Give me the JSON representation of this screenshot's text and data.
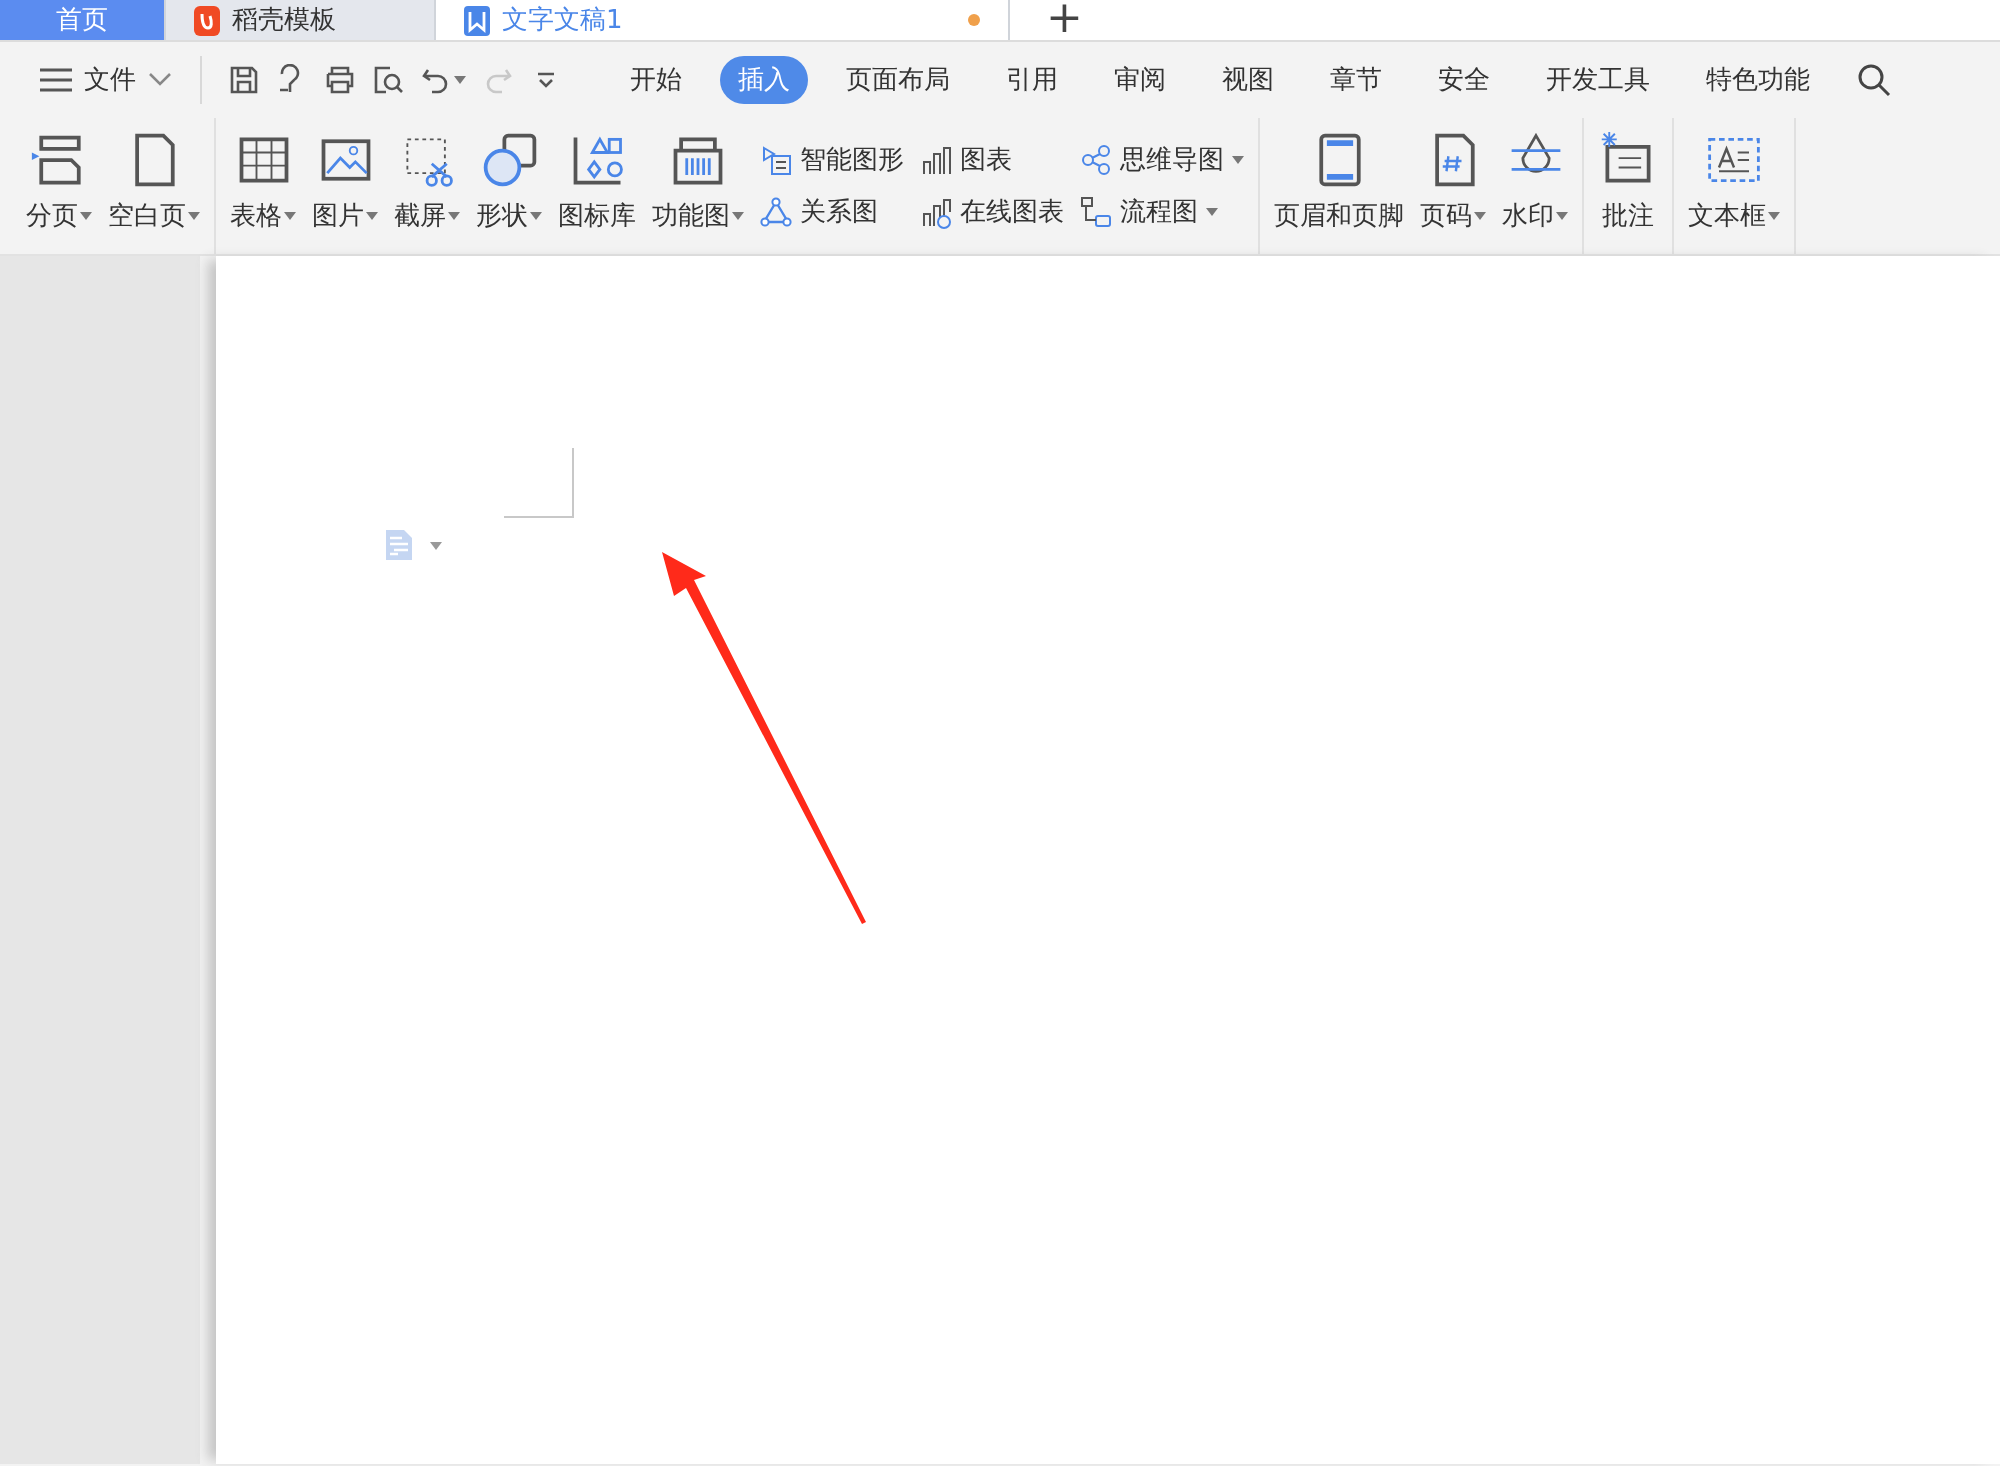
{
  "tabs": [
    {
      "label": "首页",
      "kind": "home",
      "selected": false,
      "modified": false
    },
    {
      "label": "稻壳模板",
      "kind": "docer",
      "selected": false,
      "modified": false
    },
    {
      "label": "文字文稿1",
      "kind": "doc",
      "selected": true,
      "modified": true
    }
  ],
  "new_tab": "+",
  "menu": {
    "file": "文件",
    "quick_access": [
      {
        "kind": "save",
        "disabled": false
      },
      {
        "kind": "format",
        "disabled": false
      },
      {
        "kind": "print",
        "disabled": false
      },
      {
        "kind": "preview",
        "disabled": false
      },
      {
        "kind": "undo",
        "disabled": false
      },
      {
        "kind": "redo",
        "disabled": true
      },
      {
        "kind": "more",
        "disabled": false
      }
    ],
    "tabs": [
      {
        "label": "开始",
        "selected": false
      },
      {
        "label": "插入",
        "selected": true
      },
      {
        "label": "页面布局",
        "selected": false
      },
      {
        "label": "引用",
        "selected": false
      },
      {
        "label": "审阅",
        "selected": false
      },
      {
        "label": "视图",
        "selected": false
      },
      {
        "label": "章节",
        "selected": false
      },
      {
        "label": "安全",
        "selected": false
      },
      {
        "label": "开发工具",
        "selected": false
      },
      {
        "label": "特色功能",
        "selected": false
      }
    ]
  },
  "ribbon": {
    "groups": [
      {
        "items": [
          {
            "kind": "large",
            "label": "分页",
            "dropdown": true
          },
          {
            "kind": "large",
            "label": "空白页",
            "dropdown": true
          }
        ]
      },
      {
        "items": [
          {
            "kind": "large",
            "label": "表格",
            "dropdown": true
          },
          {
            "kind": "large",
            "label": "图片",
            "dropdown": true
          },
          {
            "kind": "large",
            "label": "截屏",
            "dropdown": true
          },
          {
            "kind": "large",
            "label": "形状",
            "dropdown": true
          },
          {
            "kind": "large",
            "label": "图标库",
            "dropdown": false
          },
          {
            "kind": "large",
            "label": "功能图",
            "dropdown": true
          },
          {
            "kind": "stack",
            "rows": [
              {
                "label": "智能图形",
                "dropdown": false
              },
              {
                "label": "关系图",
                "dropdown": false
              }
            ]
          },
          {
            "kind": "stack",
            "rows": [
              {
                "label": "图表",
                "dropdown": false
              },
              {
                "label": "在线图表",
                "dropdown": false
              }
            ]
          },
          {
            "kind": "stack",
            "rows": [
              {
                "label": "思维导图",
                "dropdown": true
              },
              {
                "label": "流程图",
                "dropdown": true
              }
            ]
          }
        ]
      },
      {
        "items": [
          {
            "kind": "large",
            "label": "页眉和页脚",
            "dropdown": false
          },
          {
            "kind": "large",
            "label": "页码",
            "dropdown": true
          },
          {
            "kind": "large",
            "label": "水印",
            "dropdown": true
          }
        ]
      },
      {
        "items": [
          {
            "kind": "large",
            "label": "批注",
            "dropdown": false
          }
        ]
      },
      {
        "items": [
          {
            "kind": "large",
            "label": "文本框",
            "dropdown": true
          }
        ]
      }
    ]
  }
}
